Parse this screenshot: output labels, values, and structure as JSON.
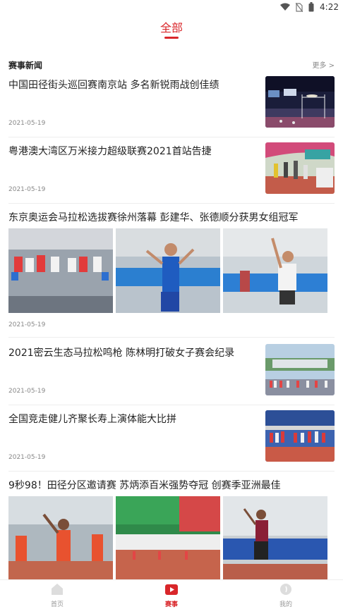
{
  "status_bar": {
    "time": "4:22"
  },
  "top_tab": {
    "label": "全部"
  },
  "section": {
    "title": "赛事新闻",
    "more": "更多 >"
  },
  "news": [
    {
      "title": "中国田径街头巡回赛南京站 多名新锐雨战创佳绩",
      "date": "2021-05-19"
    },
    {
      "title": "粤港澳大湾区万米接力超级联赛2021首站告捷",
      "date": "2021-05-19"
    },
    {
      "title": "东京奥运会马拉松选拔赛徐州落幕 彭建华、张德顺分获男女组冠军",
      "date": "2021-05-19"
    },
    {
      "title": "2021密云生态马拉松鸣枪 陈林明打破女子赛会纪录",
      "date": "2021-05-19"
    },
    {
      "title": "全国竞走健儿齐聚长寿上演体能大比拼",
      "date": "2021-05-19"
    },
    {
      "title": "9秒98！田径分区邀请赛 苏炳添百米强势夺冠 创赛季亚洲最佳",
      "date": ""
    }
  ],
  "bottom_nav": [
    {
      "label": "首页",
      "icon": "home-icon"
    },
    {
      "label": "赛事",
      "icon": "events-icon"
    },
    {
      "label": "我的",
      "icon": "profile-icon"
    }
  ],
  "colors": {
    "accent": "#d9262a",
    "muted": "#888888"
  }
}
